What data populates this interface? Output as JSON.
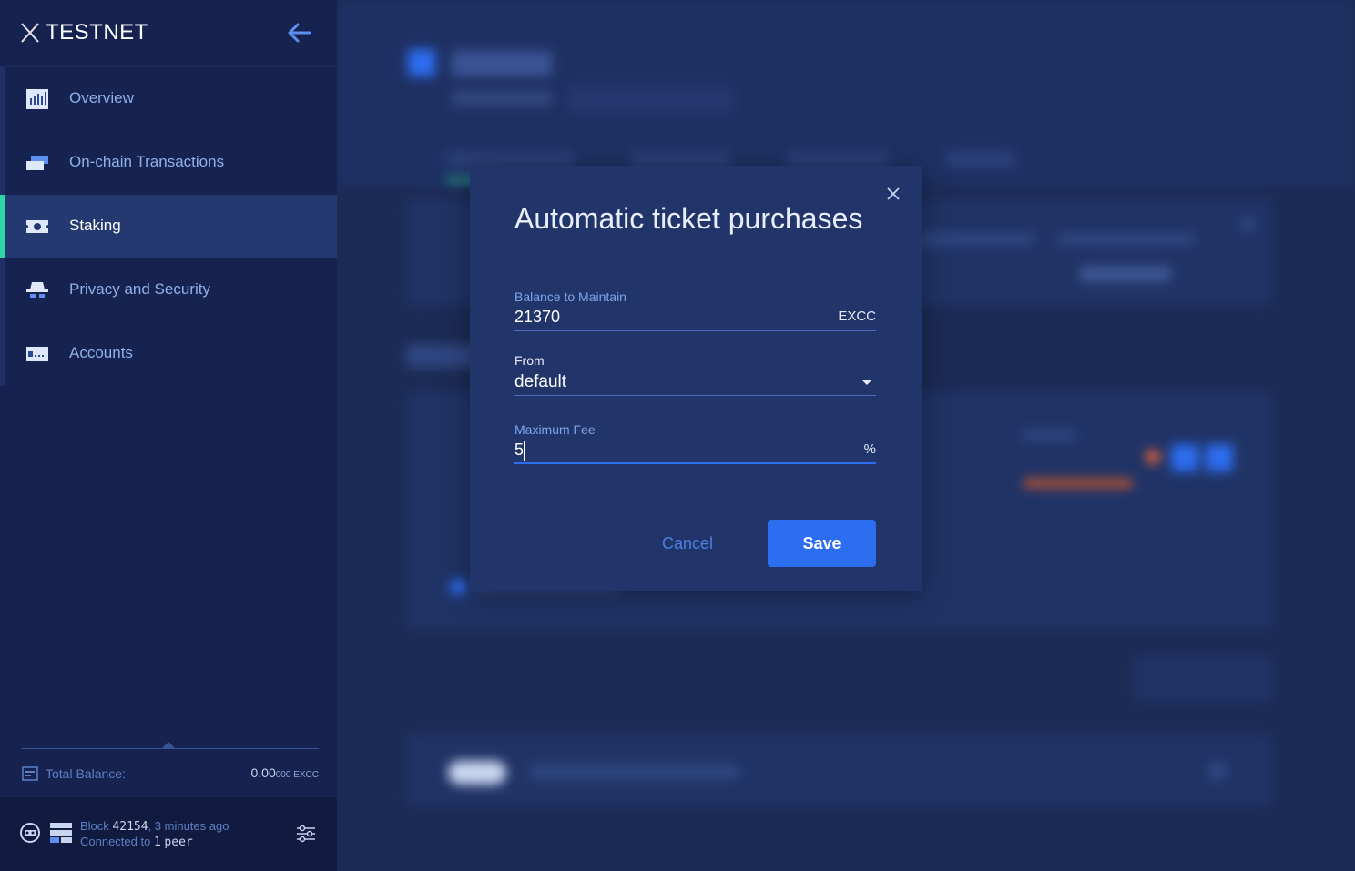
{
  "app": {
    "title": "TESTNET"
  },
  "sidebar": {
    "items": [
      {
        "label": "Overview",
        "icon": "overview-icon"
      },
      {
        "label": "On-chain Transactions",
        "icon": "transactions-icon"
      },
      {
        "label": "Staking",
        "icon": "ticket-icon",
        "active": true
      },
      {
        "label": "Privacy and Security",
        "icon": "privacy-icon"
      },
      {
        "label": "Accounts",
        "icon": "accounts-icon"
      }
    ],
    "balance": {
      "label": "Total Balance:",
      "value_main": "0.00",
      "value_small": "000 EXCC"
    },
    "status": {
      "block_label": "Block",
      "block_number": "42154",
      "block_age": ", 3 minutes ago",
      "connected_label": "Connected to",
      "peer_count": "1",
      "peer_label": "peer"
    }
  },
  "modal": {
    "title": "Automatic ticket purchases",
    "balance_field": {
      "label": "Balance to Maintain",
      "value": "21370",
      "unit": "EXCC"
    },
    "from_field": {
      "label": "From",
      "value": "default"
    },
    "fee_field": {
      "label": "Maximum Fee",
      "value": "5",
      "unit": "%"
    },
    "cancel_label": "Cancel",
    "save_label": "Save"
  },
  "colors": {
    "accent": "#2d6df0",
    "active_indicator": "#2ed8a3",
    "sidebar_bg": "#162250",
    "modal_bg": "#22356a"
  }
}
